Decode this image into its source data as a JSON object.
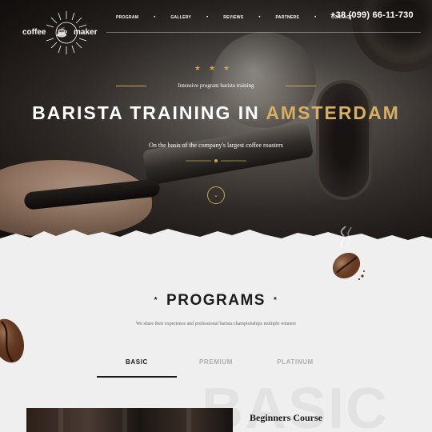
{
  "header": {
    "logo": {
      "left_word": "coffee",
      "right_word": "maker"
    },
    "nav": [
      "PROGRAM",
      "GALLERY",
      "REVIEWS",
      "PARTNERS",
      "CONTACT"
    ],
    "phone": "+38 (099) 66-11-730"
  },
  "hero": {
    "stars": "★★★",
    "kicker": "Intensive program barista training",
    "title_main": "BARISTA TRAINING IN ",
    "title_accent": "AMSTERDAM",
    "subtitle": "On the basis of the company's largest coffee roasters",
    "scroll_icon": "chevron-down-icon"
  },
  "programs": {
    "star": "*",
    "title": "PROGRAMS",
    "subtitle": "We share their experience and professional barista championships multiple winners",
    "tabs": [
      "BASIC",
      "PREMIUM",
      "PLATINUM"
    ],
    "active_tab": "BASIC",
    "bg_word": "BASIC",
    "course_title": "Beginners Course"
  },
  "colors": {
    "accent": "#d8ae63",
    "dark": "#1b1b1b",
    "paper": "#efefef"
  }
}
